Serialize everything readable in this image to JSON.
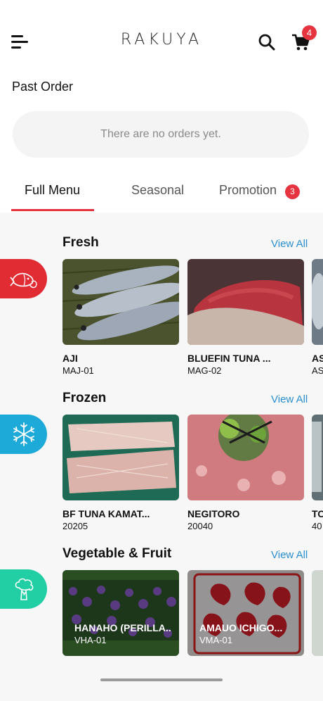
{
  "header": {
    "brand": "RAKUYA",
    "cart_count": "4"
  },
  "past_order": {
    "title": "Past Order",
    "empty_message": "There are no orders yet."
  },
  "tabs": [
    {
      "label": "Full Menu",
      "active": true
    },
    {
      "label": "Seasonal",
      "active": false
    },
    {
      "label": "Promotion",
      "active": false,
      "badge": "3"
    }
  ],
  "sections": [
    {
      "title": "Fresh",
      "view_all": "View All",
      "icon": "fish-icon",
      "color": "#e12c34",
      "items": [
        {
          "name": "AJI",
          "code": "MAJ-01"
        },
        {
          "name": "BLUEFIN TUNA ...",
          "code": "MAG-02"
        },
        {
          "name": "AS",
          "code": "AS"
        }
      ]
    },
    {
      "title": "Frozen",
      "view_all": "View All",
      "icon": "snowflake-icon",
      "color": "#1eaad8",
      "items": [
        {
          "name": "BF TUNA KAMAT...",
          "code": "20205"
        },
        {
          "name": "NEGITORO",
          "code": "20040"
        },
        {
          "name": "TO",
          "code": "40"
        }
      ]
    },
    {
      "title": "Vegetable & Fruit",
      "view_all": "View All",
      "icon": "broccoli-icon",
      "color": "#22cfa4",
      "items": [
        {
          "name": "HANAHO (PERILLA..",
          "code": "VHA-01"
        },
        {
          "name": "AMAUO ICHIGO...",
          "code": "VMA-01"
        }
      ]
    }
  ]
}
